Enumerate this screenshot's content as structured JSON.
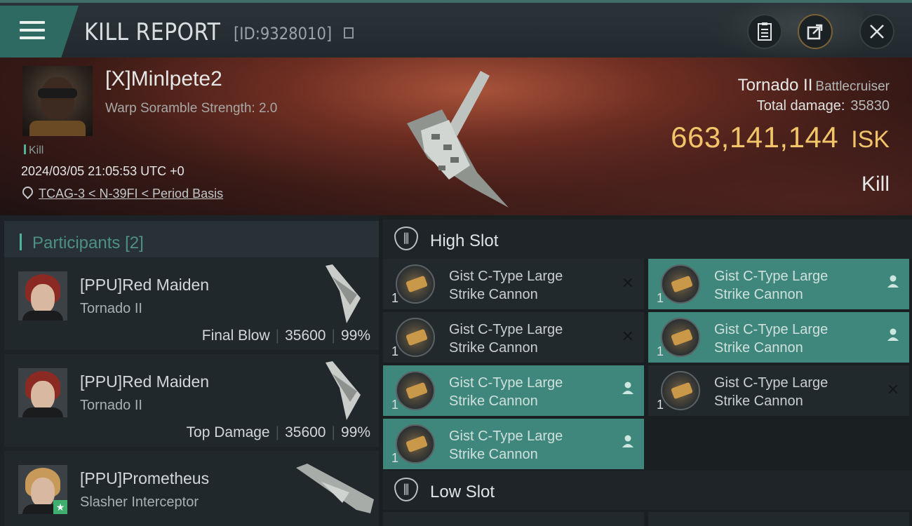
{
  "header": {
    "title": "KILL REPORT",
    "id_label": "[ID:9328010]"
  },
  "victim": {
    "name": "[X]Minlpete2",
    "sub": "Warp Soramble Strength: 2.0",
    "tag": "Kill",
    "time": "2024/03/05 21:05:53 UTC +0",
    "location": "TCAG-3 < N-39FI < Period Basis",
    "ship": "Tornado II",
    "ship_class": "Battlecruiser",
    "total_damage_label": "Total damage:",
    "total_damage": "35830",
    "isk_value": "663,141,144",
    "isk_unit": "ISK",
    "result": "Kill"
  },
  "participants": {
    "label": "Participants",
    "count": "[2]",
    "rows": [
      {
        "name": "[PPU]Red Maiden",
        "ship": "Tornado II",
        "role": "Final Blow",
        "damage": "35600",
        "percent": "99%"
      },
      {
        "name": "[PPU]Red Maiden",
        "ship": "Tornado II",
        "role": "Top Damage",
        "damage": "35600",
        "percent": "99%"
      },
      {
        "name": "[PPU]Prometheus",
        "ship": "Slasher Interceptor"
      }
    ]
  },
  "slots": {
    "high_label": "High Slot",
    "low_label": "Low Slot",
    "modules": [
      {
        "name1": "Gist C-Type Large",
        "name2": "Strike Cannon",
        "qty": "1",
        "status": "destroyed"
      },
      {
        "name1": "Gist C-Type Large",
        "name2": "Strike Cannon",
        "qty": "1",
        "status": "dropped"
      },
      {
        "name1": "Gist C-Type Large",
        "name2": "Strike Cannon",
        "qty": "1",
        "status": "destroyed"
      },
      {
        "name1": "Gist C-Type Large",
        "name2": "Strike Cannon",
        "qty": "1",
        "status": "dropped"
      },
      {
        "name1": "Gist C-Type Large",
        "name2": "Strike Cannon",
        "qty": "1",
        "status": "dropped"
      },
      {
        "name1": "Gist C-Type Large",
        "name2": "Strike Cannon",
        "qty": "1",
        "status": "destroyed"
      },
      {
        "name1": "Gist C-Type Large",
        "name2": "Strike Cannon",
        "qty": "1",
        "status": "dropped"
      }
    ]
  },
  "colors": {
    "accent": "#3f877c",
    "isk": "#f1c46a"
  }
}
